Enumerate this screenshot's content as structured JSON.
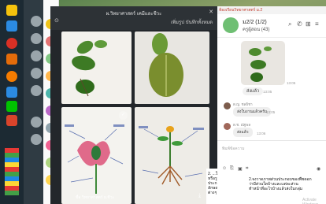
{
  "album": {
    "title": "ผ.วิทยาศาสตร์ เคมีและชีวะ",
    "action_left": "เพิ่มรูป",
    "action_right": "บันทึกทั้งหมด",
    "photos": [
      {
        "caption": ""
      },
      {
        "caption": ""
      },
      {
        "caption": "ชื่อ วิทยาศาสตร์ ผ.ชีวะ"
      },
      {
        "caption": ""
      }
    ]
  },
  "chat": {
    "window_title": "ห้องเรียนวิทยาศาสตร์ ม.2",
    "group_name": "ม2/2 (1/2)",
    "group_sub": "ครูผู้สอน (43)",
    "photo_time": "13:05",
    "msg_text": "ส่งแล้ว",
    "msg_time": "13:05",
    "sender1": "ด.ญ. ชลธิชา",
    "bubble1": "ส่งใบงานแล้วครับ",
    "time1": "13:05",
    "sender2": "ด.ช. ณัฐพล",
    "bubble2": "ส่งแล้ว",
    "time2": "13:06",
    "input_placeholder": "พิมพ์ข้อความ",
    "preview_left": "2. ...ให้นักเรียน การ์ตูนหรือรูป\nประกอบพร้อมอธิบายลักษณะ\nต่างๆ เช่น ใบ ลำต้น",
    "preview_right": "2.จงวาดภาพส่วนประกอบของพืชดอก\nว่ามีส่วนใดบ้างและแต่ละส่วน\nทำหน้าที่อะไรบ้างแล้วส่งในกลุ่ม",
    "watermark": "Activate Windows"
  }
}
